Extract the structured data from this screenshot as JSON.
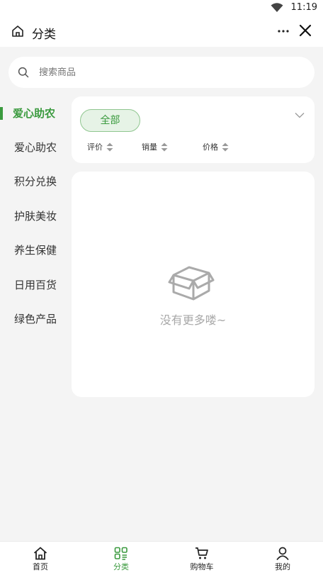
{
  "status_bar": {
    "time": "11:19"
  },
  "titlebar": {
    "title": "分类"
  },
  "search": {
    "placeholder": "搜索商品"
  },
  "sidebar": {
    "items": [
      {
        "label": "爱心助农",
        "active": true
      },
      {
        "label": "爱心助农",
        "active": false
      },
      {
        "label": "积分兑换",
        "active": false
      },
      {
        "label": "护肤美妆",
        "active": false
      },
      {
        "label": "养生保健",
        "active": false
      },
      {
        "label": "日用百货",
        "active": false
      },
      {
        "label": "绿色产品",
        "active": false
      }
    ]
  },
  "filter": {
    "chip": "全部",
    "sorts": [
      "评价",
      "销量",
      "价格"
    ]
  },
  "empty": {
    "text": "没有更多喽~"
  },
  "tabbar": {
    "tabs": [
      {
        "label": "首页",
        "icon": "home-icon"
      },
      {
        "label": "分类",
        "icon": "category-icon",
        "active": true
      },
      {
        "label": "购物车",
        "icon": "cart-icon"
      },
      {
        "label": "我的",
        "icon": "profile-icon"
      }
    ]
  },
  "colors": {
    "accent": "#3a9a3e",
    "chip_bg": "#e6f3e6",
    "page_bg": "#f4f4f4"
  }
}
